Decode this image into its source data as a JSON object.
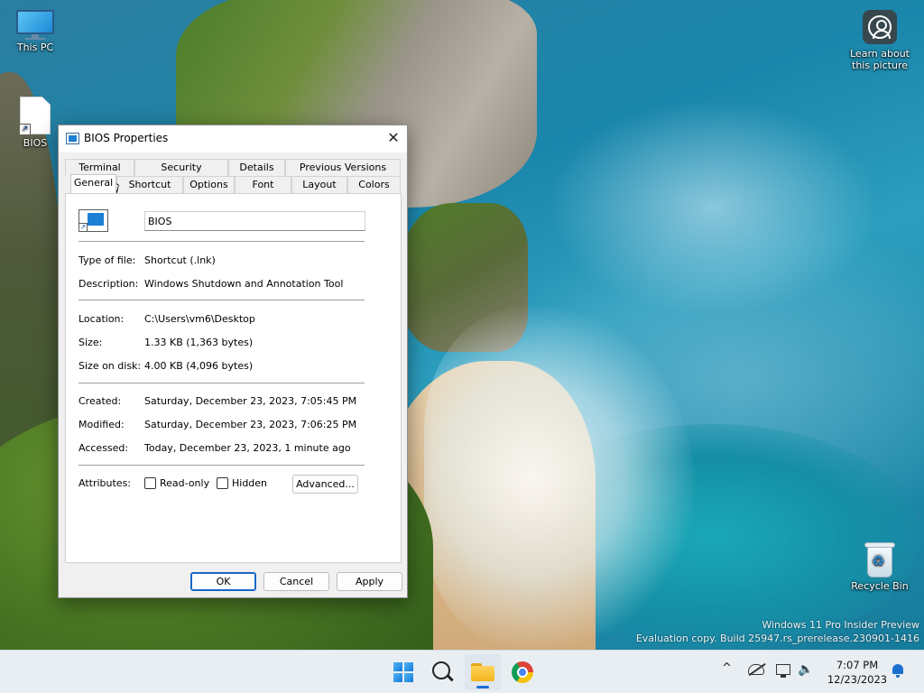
{
  "desktop": {
    "icons": [
      {
        "label": "This PC",
        "icon": "monitor-icon"
      },
      {
        "label": "BIOS",
        "icon": "shortcut-file-icon"
      },
      {
        "label": "Learn about this picture",
        "icon": "learn-about-picture-icon"
      },
      {
        "label": "Recycle Bin",
        "icon": "recycle-bin-icon"
      }
    ],
    "watermark": {
      "line1": "Windows 11 Pro Insider Preview",
      "line2": "Evaluation copy. Build 25947.rs_prerelease.230901-1416"
    }
  },
  "dialog": {
    "title": "BIOS Properties",
    "close_label": "✕",
    "tabs_back": [
      "Terminal",
      "Security",
      "Details",
      "Previous Versions"
    ],
    "tabs_front": [
      "General",
      "Shortcut",
      "Options",
      "Font",
      "Layout",
      "Colors"
    ],
    "active_tab": "General",
    "name_value": "BIOS",
    "fields": {
      "type_label": "Type of file:",
      "type_value": "Shortcut (.lnk)",
      "description_label": "Description:",
      "description_value": "Windows Shutdown and Annotation Tool",
      "location_label": "Location:",
      "location_value": "C:\\Users\\vm6\\Desktop",
      "size_label": "Size:",
      "size_value": "1.33 KB (1,363 bytes)",
      "size_on_disk_label": "Size on disk:",
      "size_on_disk_value": "4.00 KB (4,096 bytes)",
      "created_label": "Created:",
      "created_value": "Saturday, December 23, 2023, 7:05:45 PM",
      "modified_label": "Modified:",
      "modified_value": "Saturday, December 23, 2023, 7:06:25 PM",
      "accessed_label": "Accessed:",
      "accessed_value": "Today, December 23, 2023, 1 minute ago",
      "attributes_label": "Attributes:"
    },
    "attributes": {
      "readonly_label": "Read-only",
      "readonly_checked": false,
      "hidden_label": "Hidden",
      "hidden_checked": false,
      "advanced_label": "Advanced..."
    },
    "buttons": {
      "ok": "OK",
      "cancel": "Cancel",
      "apply": "Apply"
    }
  },
  "taskbar": {
    "apps": [
      "start-icon",
      "search-icon",
      "file-explorer-icon",
      "chrome-icon"
    ],
    "active_app": "file-explorer-icon",
    "tray": {
      "chevron": "^",
      "time": "7:07 PM",
      "date": "12/23/2023"
    }
  },
  "colors": {
    "accent": "#1767c2",
    "taskbar": "#e9eef3",
    "dialog_bg": "#f0f0f0"
  }
}
